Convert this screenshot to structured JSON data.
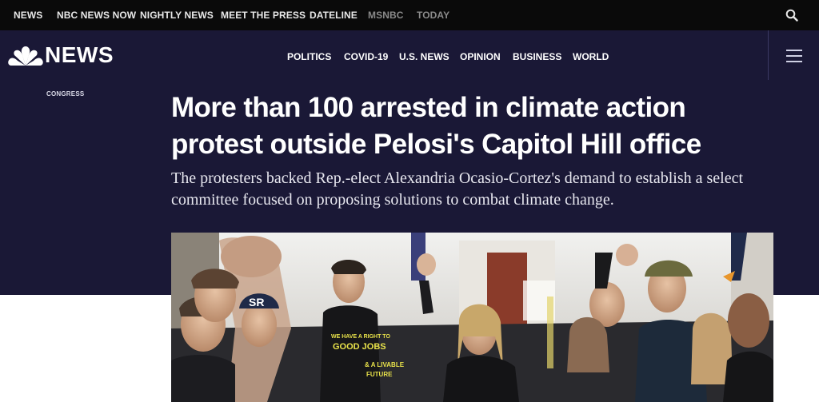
{
  "topnav": {
    "items": [
      "NEWS",
      "NBC NEWS NOW",
      "NIGHTLY NEWS",
      "MEET THE PRESS",
      "DATELINE",
      "MSNBC",
      "TODAY"
    ]
  },
  "brand": {
    "logo_text": "NEWS"
  },
  "mainnav": {
    "items": [
      "POLITICS",
      "COVID-19",
      "U.S. NEWS",
      "OPINION",
      "BUSINESS",
      "WORLD"
    ]
  },
  "article": {
    "eyebrow": "CONGRESS",
    "headline": "More than 100 arrested in climate action protest outside Pelosi's Capitol Hill office",
    "dek": "The protesters backed Rep.-elect Alexandria Ocasio-Cortez's demand to establish a select committee focused on proposing solutions to combat climate change."
  },
  "photo_signs": {
    "sign_1": "WE HAVE A RIGHT TO",
    "sign_2": "GOOD JOBS",
    "sign_3": "& A LIVABLE",
    "sign_4": "FUTURE",
    "hat": "SR"
  },
  "colors": {
    "topbar": "#0a0a0a",
    "header": "#1a1836",
    "text": "#ffffff"
  },
  "icons": [
    "search-icon",
    "peacock-logo-icon",
    "hamburger-menu-icon"
  ]
}
